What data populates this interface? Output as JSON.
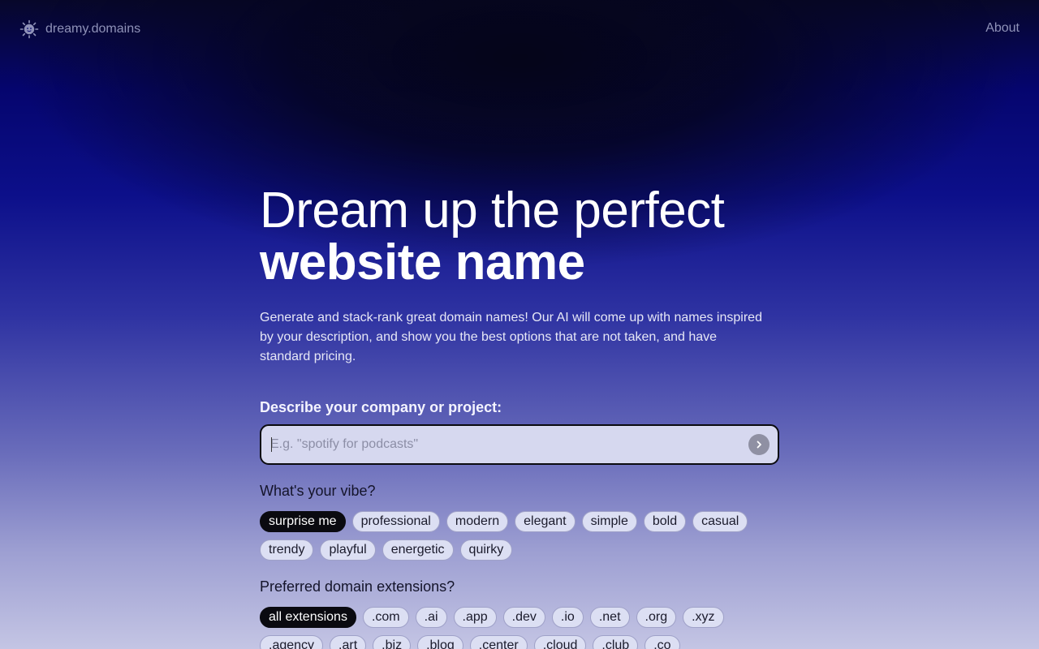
{
  "header": {
    "brand_name": "dreamy.domains",
    "brand_icon": "sun-face-icon",
    "about_label": "About"
  },
  "hero": {
    "title_line1": "Dream up the perfect",
    "title_line2": "website name",
    "intro": "Generate and stack-rank great domain names! Our AI will come up with names inspired by your description, and show you the best options that are not taken, and have standard pricing."
  },
  "form": {
    "describe_label": "Describe your company or project:",
    "input_value": "",
    "input_placeholder": "E.g. \"spotify for podcasts\"",
    "submit_icon": "chevron-right-icon"
  },
  "vibe": {
    "title": "What's your vibe?",
    "options": [
      {
        "label": "surprise me",
        "selected": true
      },
      {
        "label": "professional",
        "selected": false
      },
      {
        "label": "modern",
        "selected": false
      },
      {
        "label": "elegant",
        "selected": false
      },
      {
        "label": "simple",
        "selected": false
      },
      {
        "label": "bold",
        "selected": false
      },
      {
        "label": "casual",
        "selected": false
      },
      {
        "label": "trendy",
        "selected": false
      },
      {
        "label": "playful",
        "selected": false
      },
      {
        "label": "energetic",
        "selected": false
      },
      {
        "label": "quirky",
        "selected": false
      }
    ]
  },
  "extensions": {
    "title": "Preferred domain extensions?",
    "options": [
      {
        "label": "all extensions",
        "selected": true
      },
      {
        "label": ".com",
        "selected": false
      },
      {
        "label": ".ai",
        "selected": false
      },
      {
        "label": ".app",
        "selected": false
      },
      {
        "label": ".dev",
        "selected": false
      },
      {
        "label": ".io",
        "selected": false
      },
      {
        "label": ".net",
        "selected": false
      },
      {
        "label": ".org",
        "selected": false
      },
      {
        "label": ".xyz",
        "selected": false
      },
      {
        "label": ".agency",
        "selected": false
      },
      {
        "label": ".art",
        "selected": false
      },
      {
        "label": ".biz",
        "selected": false
      },
      {
        "label": ".blog",
        "selected": false
      },
      {
        "label": ".center",
        "selected": false
      },
      {
        "label": ".cloud",
        "selected": false
      },
      {
        "label": ".club",
        "selected": false
      },
      {
        "label": ".co",
        "selected": false
      }
    ]
  },
  "colors": {
    "accent_dark": "#0a0a10",
    "chip_bg": "#dcdff3",
    "input_bg": "#d6d8ef"
  }
}
